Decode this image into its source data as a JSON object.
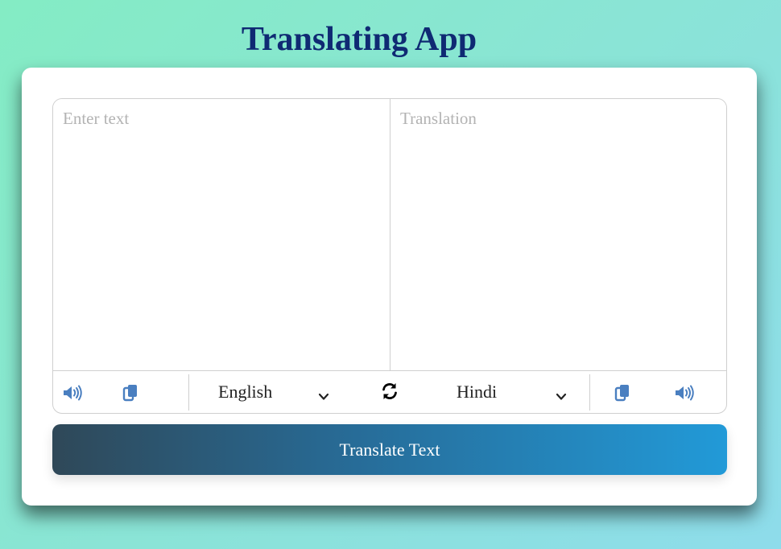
{
  "app": {
    "title": "Translating App"
  },
  "source": {
    "placeholder": "Enter text",
    "value": "",
    "language": "English",
    "speak_icon": "volume-up-icon",
    "copy_icon": "copy-icon"
  },
  "target": {
    "placeholder": "Translation",
    "value": "",
    "language": "Hindi",
    "speak_icon": "volume-up-icon",
    "copy_icon": "copy-icon"
  },
  "exchange_icon": "sync-icon",
  "translate_button": {
    "label": "Translate Text"
  },
  "colors": {
    "title": "#0f2a73",
    "icon": "#4a7fc0",
    "button_gradient_start": "#2f4858",
    "button_gradient_end": "#229ad8"
  }
}
